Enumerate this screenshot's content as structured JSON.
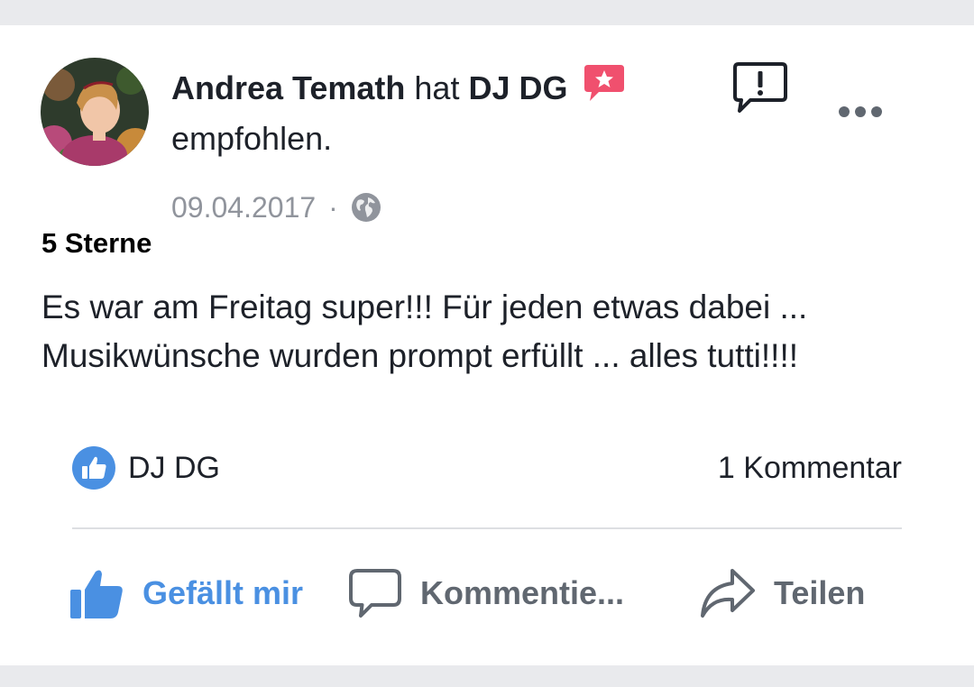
{
  "post": {
    "author": "Andrea Temath",
    "connector": "hat",
    "page_name": "DJ DG",
    "action_text": "empfohlen.",
    "date": "09.04.2017",
    "separator": "·",
    "privacy_icon": "globe-icon",
    "report_icon": "report-speech-bubble-icon",
    "more_icon": "more-dots-icon",
    "badge_icon": "recommendation-star-icon",
    "rating_label": "5 Sterne",
    "review_line_1": "Es war am Freitag super!!! Für jeden etwas dabei ...",
    "review_line_2": "Musikwünsche wurden prompt erfüllt ... alles tutti!!!!"
  },
  "reactions": {
    "icon": "like-thumb-badge-icon",
    "reactor": "DJ DG",
    "comment_count": "1 Kommentar"
  },
  "actions": {
    "like_label": "Gefällt mir",
    "comment_label": "Kommentie...",
    "share_label": "Teilen"
  },
  "colors": {
    "facebook_blue": "#4a90e2",
    "badge_red": "#f0506e",
    "text_dark": "#1d2129",
    "text_muted": "#90949c",
    "action_gray": "#606770",
    "divider": "#dddfe2",
    "page_bg": "#e9eaed"
  }
}
